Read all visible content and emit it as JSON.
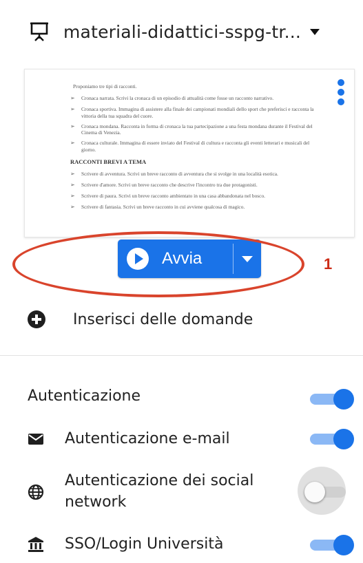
{
  "header": {
    "title": "materiali-didattici-sspg-tr...",
    "icon": "presentation-icon",
    "caret_icon": "caret-down-icon"
  },
  "preview": {
    "menu_icon": "kebab-menu-icon",
    "intro": "Proponiamo tre tipi di racconti.",
    "items_a": [
      "Cronaca narrata. Scrivi la cronaca di un episodio di attualità come fosse un racconto narrativo.",
      "Cronaca sportiva. Immagina di assistere alla finale dei campionati mondiali dello sport che preferisci e racconta la vittoria della tua squadra del cuore.",
      "Cronaca mondana. Racconta in forma di cronaca la tua partecipazione a una festa mondana durante il Festival del Cinema di Venezia.",
      "Cronaca culturale. Immagina di essere inviato del Festival di cultura e racconta gli eventi letterari e musicali del giorno."
    ],
    "heading": "RACCONTI BREVI A TEMA",
    "items_b": [
      "Scrivere di avventura. Scrivi un breve racconto di avventura che si svolge in una località esotica.",
      "Scrivere d'amore. Scrivi un breve racconto che descrive l'incontro tra due protagonisti.",
      "Scrivere di paura. Scrivi un breve racconto ambientato in una casa abbandonata nel bosco.",
      "Scrivere di fantasia. Scrivi un breve racconto in cui avviene qualcosa di magico."
    ]
  },
  "start_button": {
    "label": "Avvia",
    "play_icon": "play-icon",
    "dropdown_icon": "caret-down-icon"
  },
  "annotation": {
    "number": "1",
    "color": "#d9442c"
  },
  "insert_questions": {
    "label": "Inserisci delle domande",
    "icon": "plus-circle-icon"
  },
  "authentication": {
    "heading": "Autenticazione",
    "heading_enabled": true,
    "options": [
      {
        "label": "Autenticazione e-mail",
        "icon": "envelope-icon",
        "enabled": true
      },
      {
        "label": "Autenticazione dei social network",
        "icon": "globe-icon",
        "enabled": false
      },
      {
        "label": "SSO/Login Università",
        "icon": "university-icon",
        "enabled": true
      }
    ]
  },
  "colors": {
    "accent": "#1a73e8",
    "accent_light": "#8bb8f5",
    "annotation": "#d9442c"
  }
}
